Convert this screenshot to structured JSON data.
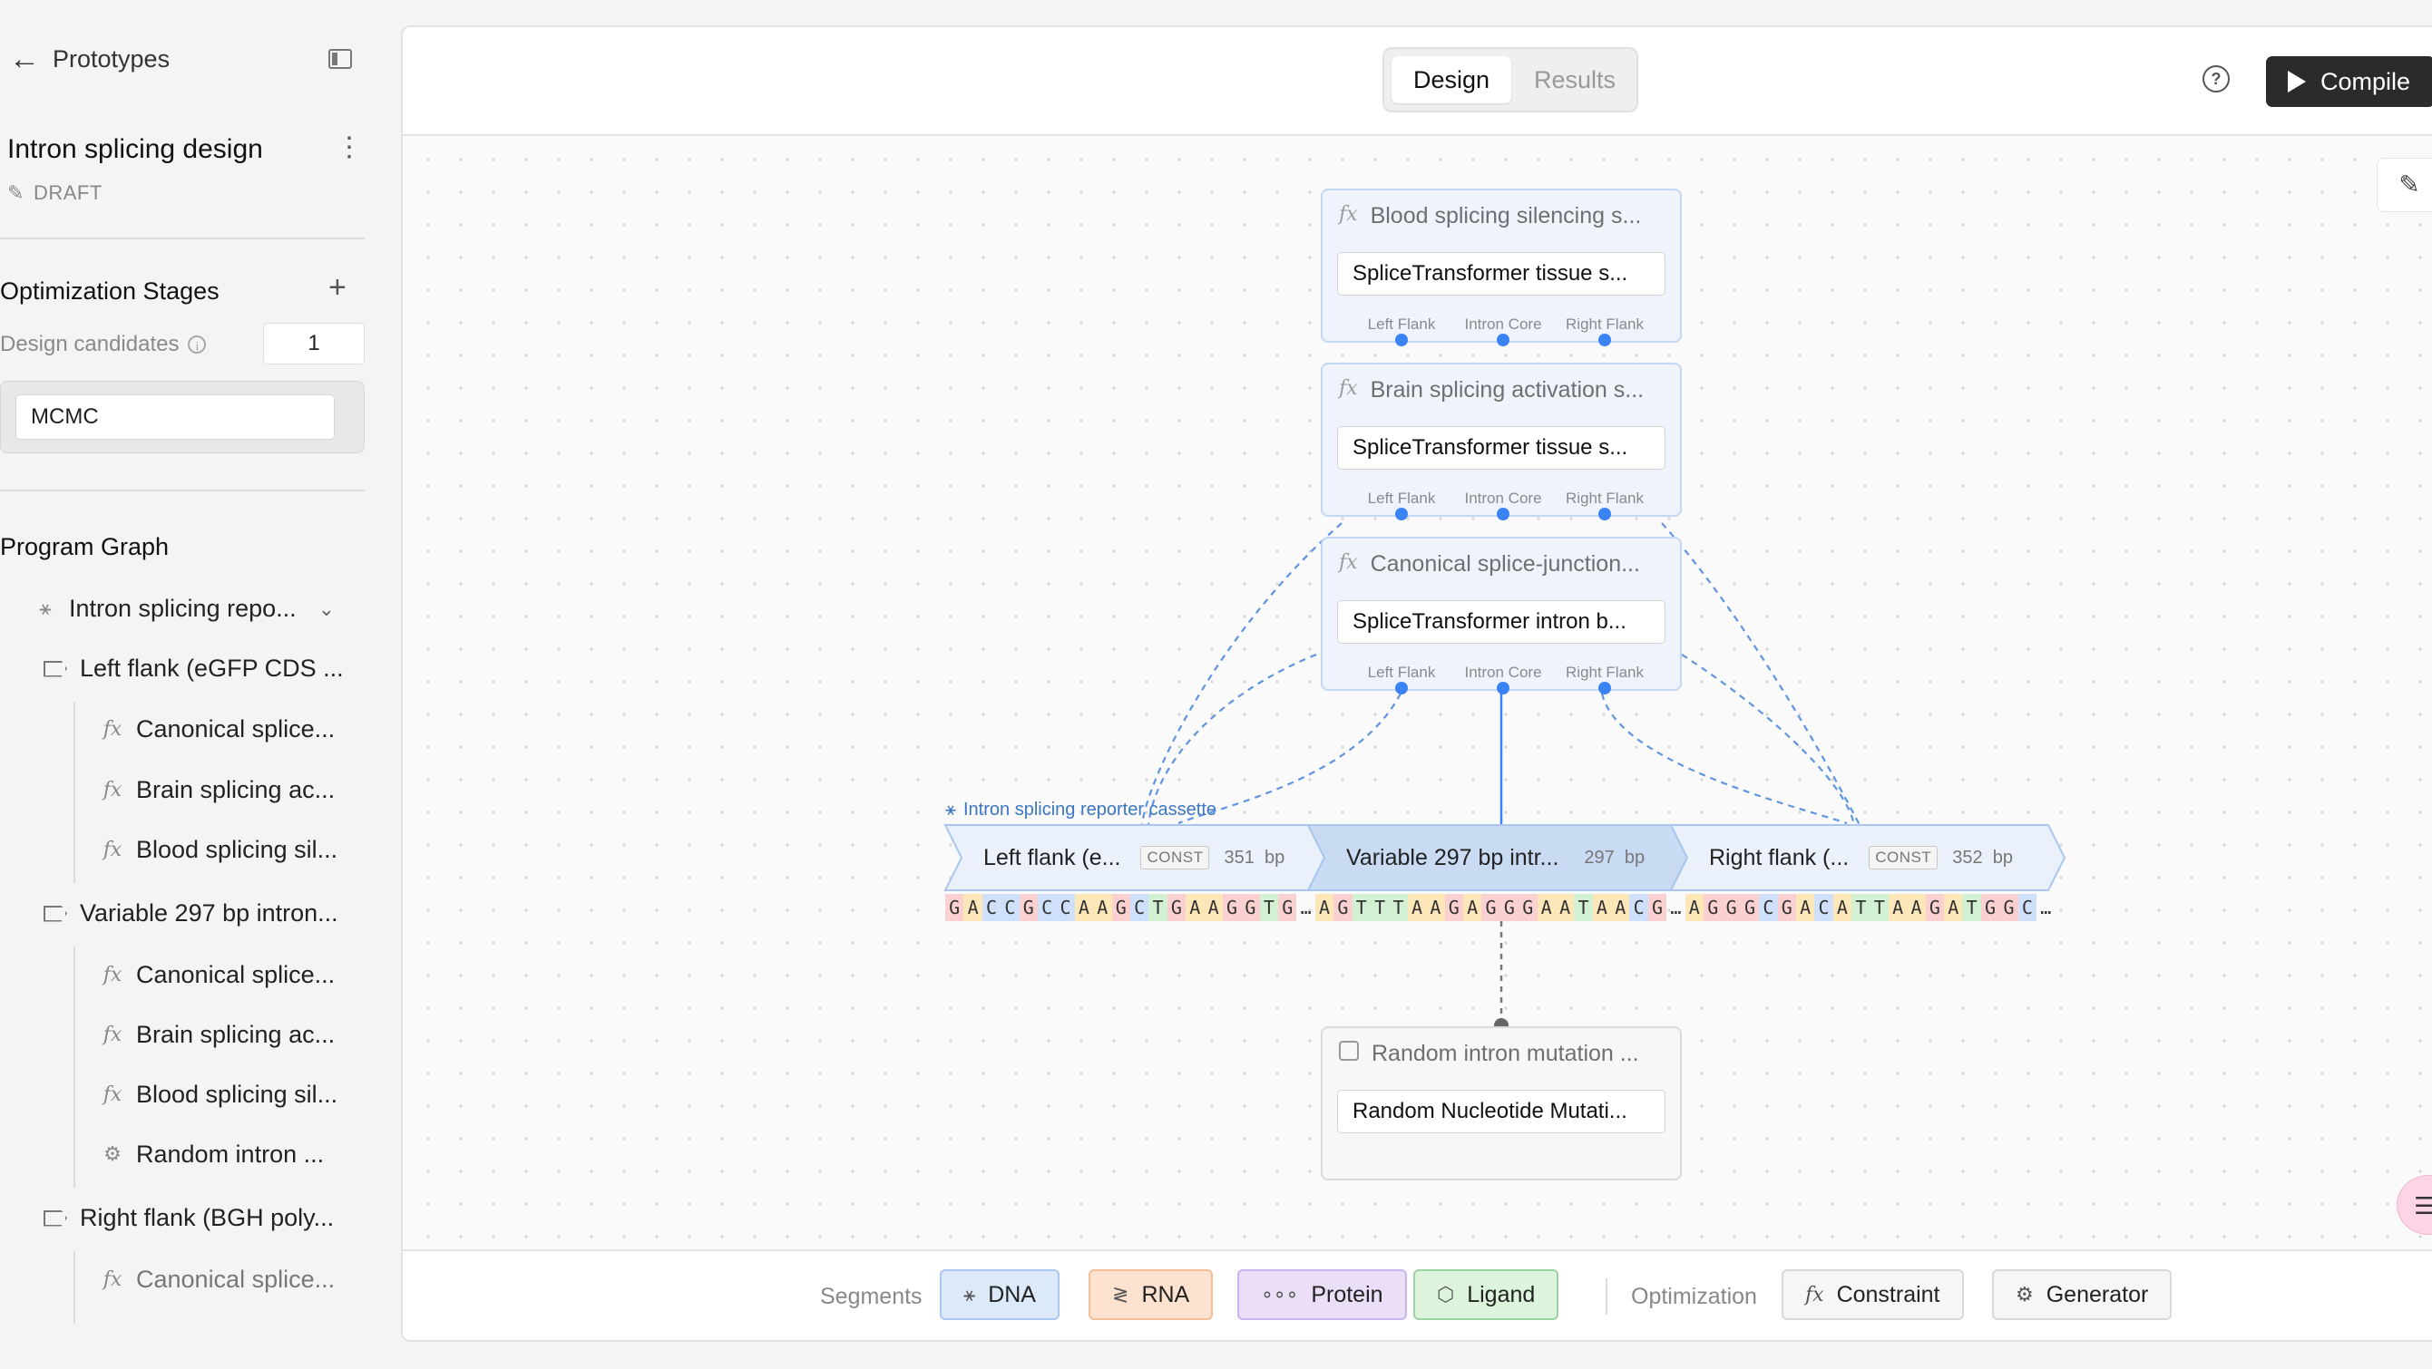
{
  "sidebar": {
    "back_label": "Prototypes",
    "project_title": "Intron splicing design",
    "status": "DRAFT",
    "optimization": {
      "title": "Optimization Stages",
      "candidates_label": "Design candidates",
      "candidates_value": "1",
      "stage_value": "MCMC"
    },
    "graph": {
      "title": "Program Graph",
      "root": "Intron splicing repo...",
      "items": [
        {
          "label": "Left flank (eGFP CDS ..."
        },
        {
          "label": "Canonical splice..."
        },
        {
          "label": "Brain splicing ac..."
        },
        {
          "label": "Blood splicing sil..."
        },
        {
          "label": "Variable 297 bp intron..."
        },
        {
          "label": "Canonical splice..."
        },
        {
          "label": "Brain splicing ac..."
        },
        {
          "label": "Blood splicing sil..."
        },
        {
          "label": "Random intron ..."
        },
        {
          "label": "Right flank (BGH poly..."
        },
        {
          "label": "Canonical splice..."
        }
      ]
    }
  },
  "header": {
    "tabs": [
      "Design",
      "Results"
    ],
    "compile_label": "Compile"
  },
  "canvas": {
    "nodes": [
      {
        "title": "Blood splicing silencing s...",
        "model": "SpliceTransformer tissue s..."
      },
      {
        "title": "Brain splicing activation s...",
        "model": "SpliceTransformer tissue s..."
      },
      {
        "title": "Canonical splice-junction...",
        "model": "SpliceTransformer intron b..."
      }
    ],
    "ports": [
      "Left Flank",
      "Intron Core",
      "Right Flank"
    ],
    "generator": {
      "title": "Random intron mutation ...",
      "model": "Random Nucleotide Mutati..."
    },
    "construct": {
      "label": "Intron splicing reporter cassette",
      "segments": [
        {
          "name": "Left flank (e...",
          "tag": "CONST",
          "length": "351",
          "unit": "bp"
        },
        {
          "name": "Variable 297 bp intr...",
          "length": "297",
          "unit": "bp"
        },
        {
          "name": "Right flank (...",
          "tag": "CONST",
          "length": "352",
          "unit": "bp"
        }
      ],
      "sequence": "GACCGCCAAGCTGAAGGTG…AGTTTAAGAGGGAATAACG…AGGGCGACATTAAGATGGC…"
    }
  },
  "bottombar": {
    "segments_label": "Segments",
    "segment_types": [
      "DNA",
      "RNA",
      "Protein",
      "Ligand"
    ],
    "optimization_label": "Optimization",
    "optimization_types": [
      "Constraint",
      "Generator"
    ]
  },
  "colors": {
    "accent_blue": "#3b82f6",
    "dna": "#dce9f9",
    "rna": "#fde3cf",
    "protein": "#eadff7",
    "ligand": "#dcf3dc",
    "base_A": "#fde6b8",
    "base_C": "#cfe0fa",
    "base_G": "#fbd0d0",
    "base_T": "#d2f0d2"
  }
}
